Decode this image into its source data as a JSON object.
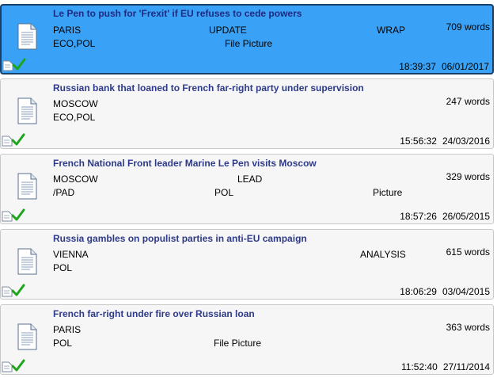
{
  "items": [
    {
      "headline": "Le Pen to push for 'Frexit' if EU refuses to cede powers",
      "location": "PARIS",
      "type": "UPDATE",
      "tag": "WRAP",
      "codes": "ECO,POL",
      "extra": "File Picture",
      "words": "709 words",
      "time": "18:39:37",
      "date": "06/01/2017",
      "selected": true
    },
    {
      "headline": "Russian bank that loaned to French far-right party under supervision",
      "location": "MOSCOW",
      "type": "",
      "tag": "",
      "codes": "ECO,POL",
      "extra": "",
      "words": "247 words",
      "time": "15:56:32",
      "date": "24/03/2016",
      "selected": false
    },
    {
      "headline": "French National Front leader Marine Le Pen visits Moscow",
      "location": "MOSCOW",
      "type": "LEAD",
      "tag": "",
      "codes": "/PAD",
      "codes2": "POL",
      "extra": "Picture",
      "words": "329 words",
      "time": "18:57:26",
      "date": "26/05/2015",
      "selected": false
    },
    {
      "headline": "Russia gambles on populist parties in anti-EU campaign",
      "location": "VIENNA",
      "type": "",
      "tag": "ANALYSIS",
      "codes": "POL",
      "extra": "",
      "words": "615 words",
      "time": "18:06:29",
      "date": "03/04/2015",
      "selected": false
    },
    {
      "headline": "French far-right under fire over Russian loan",
      "location": "PARIS",
      "type": "",
      "tag": "",
      "codes": "POL",
      "extra": "File Picture",
      "words": "363 words",
      "time": "11:52:40",
      "date": "27/11/2014",
      "selected": false
    }
  ],
  "colors": {
    "selected_background": "#3aa2f6",
    "selected_border": "#1c3f66",
    "card_background": "#f6f6f6",
    "headline_text": "#2e3a8a",
    "checkmark": "#1ea51e"
  },
  "icons": {
    "document": "document-icon",
    "status_document": "mini-document-icon",
    "status_check": "checkmark-icon"
  }
}
